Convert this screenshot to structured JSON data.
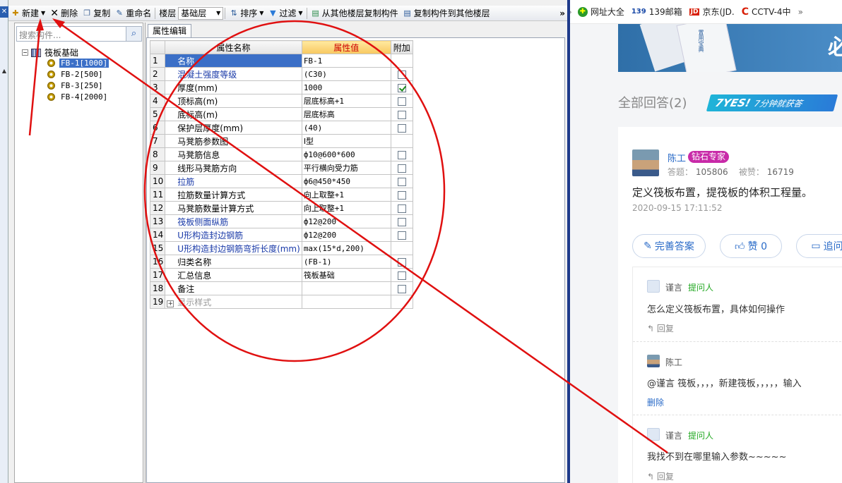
{
  "app": {
    "toolbar": {
      "new_label": "新建",
      "delete_label": "删除",
      "copy_label": "复制",
      "rename_label": "重命名",
      "floor_label": "楼层",
      "floor_value": "基础层",
      "sort_label": "排序",
      "filter_label": "过滤",
      "copy_from_other_label": "从其他楼层复制构件",
      "copy_to_other_label": "复制构件到其他楼层",
      "overflow": "»"
    },
    "left_panel": {
      "search_placeholder": "搜索构件...",
      "tree_root": "筏板基础",
      "tree_items": [
        "FB-1[1000]",
        "FB-2[500]",
        "FB-3[250]",
        "FB-4[2000]"
      ]
    },
    "property_editor": {
      "tab_label": "属性编辑",
      "headers": {
        "name": "属性名称",
        "value": "属性值",
        "add": "附加"
      },
      "rows": [
        {
          "num": "1",
          "name": "名称",
          "value": "FB-1",
          "checkbox": "none"
        },
        {
          "num": "2",
          "name": "混凝土强度等级",
          "value": "(C30)",
          "checkbox": "unchecked"
        },
        {
          "num": "3",
          "name": "厚度(mm)",
          "value": "1000",
          "checkbox": "checked"
        },
        {
          "num": "4",
          "name": "顶标高(m)",
          "value": "层底标高+1",
          "checkbox": "unchecked"
        },
        {
          "num": "5",
          "name": "底标高(m)",
          "value": "层底标高",
          "checkbox": "unchecked"
        },
        {
          "num": "6",
          "name": "保护层厚度(mm)",
          "value": "(40)",
          "checkbox": "unchecked"
        },
        {
          "num": "7",
          "name": "马凳筋参数图",
          "value": "Ⅰ型",
          "checkbox": "none"
        },
        {
          "num": "8",
          "name": "马凳筋信息",
          "value": "ф10@600*600",
          "checkbox": "unchecked"
        },
        {
          "num": "9",
          "name": "线形马凳筋方向",
          "value": "平行横向受力筋",
          "checkbox": "unchecked"
        },
        {
          "num": "10",
          "name": "拉筋",
          "value": "ф6@450*450",
          "checkbox": "unchecked"
        },
        {
          "num": "11",
          "name": "拉筋数量计算方式",
          "value": "向上取整+1",
          "checkbox": "unchecked"
        },
        {
          "num": "12",
          "name": "马凳筋数量计算方式",
          "value": "向上取整+1",
          "checkbox": "unchecked"
        },
        {
          "num": "13",
          "name": "筏板侧面纵筋",
          "value": "ф12@200",
          "checkbox": "unchecked"
        },
        {
          "num": "14",
          "name": "U形构造封边钢筋",
          "value": "ф12@200",
          "checkbox": "unchecked"
        },
        {
          "num": "15",
          "name": "U形构造封边钢筋弯折长度(mm)",
          "value": "max(15*d,200)",
          "checkbox": "none"
        },
        {
          "num": "16",
          "name": "归类名称",
          "value": "(FB-1)",
          "checkbox": "unchecked"
        },
        {
          "num": "17",
          "name": "汇总信息",
          "value": "筏板基础",
          "checkbox": "unchecked"
        },
        {
          "num": "18",
          "name": "备注",
          "value": "",
          "checkbox": "unchecked"
        },
        {
          "num": "19",
          "name": "显示样式",
          "value": "",
          "checkbox": "none"
        }
      ]
    }
  },
  "browser": {
    "bookmarks": [
      "网址大全",
      "139邮箱",
      "京东(JD.",
      "CCTV-4中",
      "»"
    ],
    "bookmark_icons": [
      "139",
      "JD",
      "C"
    ],
    "bookmark_overflow_left": "›",
    "banner_text": "置用宝典",
    "banner_big": "必",
    "all_answers": "全部回答(2)",
    "promo": {
      "yes": "7YES!",
      "text": "7分钟就获答"
    },
    "answer": {
      "user": "陈工",
      "badge": "钻石专家",
      "stats_answer_label": "答题：",
      "stats_answer_value": "105806",
      "stats_liked_label": "被赞：",
      "stats_liked_value": "16719",
      "text": "定义筏板布置，提筏板的体积工程量。",
      "time": "2020-09-15 17:11:52"
    },
    "actions": {
      "improve": "完善答案",
      "like": "赞 0",
      "followup": "追问"
    },
    "comments": [
      {
        "user": "谨言",
        "role": "提问人",
        "text": "怎么定义筏板布置，具体如何操作",
        "action": "回复"
      },
      {
        "user": "陈工",
        "role": "",
        "text": "@谨言 筏板，，，，新建筏板，，，，，输入",
        "action": "删除"
      },
      {
        "user": "谨言",
        "role": "提问人",
        "text": "我找不到在哪里输入参数~~~~~",
        "action": "回复"
      }
    ]
  },
  "annotation_color": "#e01010"
}
